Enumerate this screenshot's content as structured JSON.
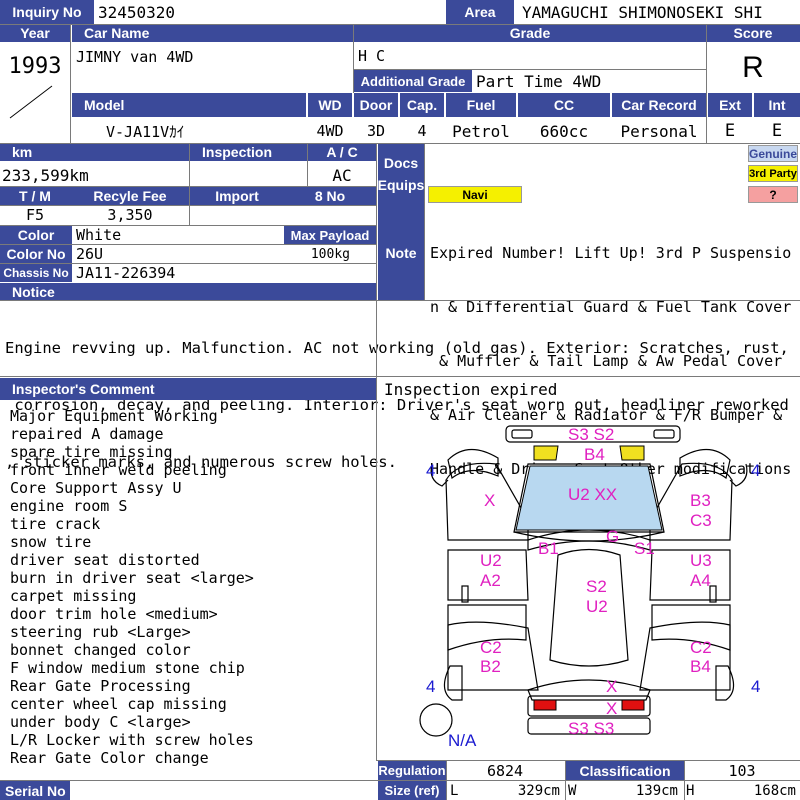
{
  "labels": {
    "inquiry_no": "Inquiry No",
    "area": "Area",
    "year": "Year",
    "car_name": "Car Name",
    "grade": "Grade",
    "score": "Score",
    "additional_grade": "Additional Grade",
    "model": "Model",
    "wd": "WD",
    "door": "Door",
    "cap": "Cap.",
    "fuel": "Fuel",
    "cc": "CC",
    "car_record": "Car Record",
    "ext": "Ext",
    "int": "Int",
    "km": "km",
    "inspection": "Inspection",
    "ac": "A / C",
    "docs": "Docs",
    "equips": "Equips",
    "tm": "T / M",
    "recycle_fee": "Recyle Fee",
    "import": "Import",
    "no8": "8 No",
    "color": "Color",
    "max_payload": "Max Payload",
    "color_no": "Color No",
    "chassis_no": "Chassis No",
    "notice": "Notice",
    "note": "Note",
    "inspector_comment": "Inspector's Comment",
    "regulation": "Regulation",
    "classification": "Classification",
    "size_ref": "Size (ref)",
    "serial_no": "Serial No",
    "size_l": "L",
    "size_w": "W",
    "size_h": "H"
  },
  "values": {
    "inquiry_no": "32450320",
    "area": "YAMAGUCHI SHIMONOSEKI SHI",
    "year": "1993",
    "car_name": "JIMNY van 4WD",
    "grade": "H C",
    "score": "R",
    "additional_grade": "Part Time 4WD",
    "model": "V-JA11Vｶｲ",
    "wd": "4WD",
    "door": "3D",
    "cap": "4",
    "fuel": "Petrol",
    "cc": "660cc",
    "car_record": "Personal",
    "ext": "E",
    "int": "E",
    "km": "233,599km",
    "inspection": "",
    "ac": "AC",
    "tm": "F5",
    "recycle_fee": "3,350",
    "import": "",
    "no8": "",
    "color": "White",
    "max_payload": "100kg",
    "color_no": "26U",
    "chassis_no": "JA11-226394",
    "regulation": "6824",
    "classification": "103",
    "size_l": "329cm",
    "size_w": "139cm",
    "size_h": "168cm",
    "serial_no": ""
  },
  "equips": {
    "genuine": "Genuine",
    "third_party": "3rd Party",
    "unknown": "?",
    "navi": "Navi"
  },
  "note_lines": [
    "Expired Number! Lift Up! 3rd P Suspensio",
    "n & Differential Guard & Fuel Tank Cover",
    " & Muffler & Tail Lamp & Aw Pedal Cover",
    "& Air Cleaner & Radiator & F/R Bumper &",
    "Handle & Driver Seat Other modifications"
  ],
  "notice_lines": [
    "Engine revving up. Malfunction. AC not working (old gas). Exterior: Scratches, rust,",
    " corrosion, decay, and peeling. Interior: Driver's seat worn out, headliner reworked",
    ", sticker marks, and numerous screw holes."
  ],
  "inspection_status": "Inspection expired",
  "comments": [
    "Major Equipment Working",
    "repaired A damage",
    "spare tire missing",
    "front inner weld peeling",
    "Core Support Assy U",
    "engine room S",
    "tire crack",
    "snow tire",
    "driver seat distorted",
    "burn in driver seat <large>",
    "carpet missing",
    "door trim hole <medium>",
    "steering rub <Large>",
    "bonnet changed color",
    "F window medium stone chip",
    "Rear Gate Processing",
    "center wheel cap missing",
    "under body C <large>",
    "L/R Locker with screw holes",
    "Rear Gate Color change"
  ],
  "diagram": {
    "damage_codes": {
      "front_bumper": "S3  S2",
      "bonnet": "B4",
      "windshield": "U2  XX",
      "roof_front": "G",
      "left_fender": "X",
      "right_fender_1": "B3",
      "right_fender_2": "C3",
      "left_pillar": "B1",
      "right_pillar": "S1",
      "left_door_1": "U2",
      "left_door_2": "A2",
      "right_door_1": "U3",
      "right_door_2": "A4",
      "roof_1": "S2",
      "roof_2": "U2",
      "left_rear_1": "C2",
      "left_rear_2": "B2",
      "right_rear_1": "C2",
      "right_rear_2": "B4",
      "tailgate_1": "X",
      "tailgate_2": "X",
      "rear_bumper": "S3  S3"
    },
    "tire_counts": [
      "4",
      "4",
      "4",
      "4"
    ],
    "spare": "N/A"
  },
  "colors": {
    "header_bg": "#3b4a9a",
    "damage_text": "#e020c0",
    "tire_text": "#1a1ad0",
    "navi_bg": "#f5f000",
    "genuine_bg": "#c8d8f0",
    "third_party_bg": "#f5f000",
    "unknown_bg": "#f5a0a0",
    "windshield": "#b8d8f0",
    "light_yellow": "#f0e020",
    "tail_red": "#e01010"
  }
}
